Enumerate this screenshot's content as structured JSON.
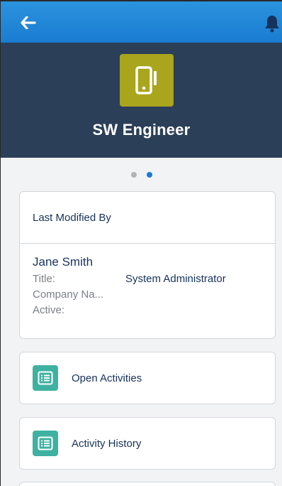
{
  "header": {
    "back_icon": "back-arrow-icon",
    "notification_icon": "bell-icon",
    "bar_color": "#1b7cd1"
  },
  "hero": {
    "title": "SW Engineer",
    "icon": "mobile-device-icon",
    "icon_color": "#a9a51c",
    "background": "#2b3f58"
  },
  "pager": {
    "count": 2,
    "active_index": 1
  },
  "last_modified_card": {
    "heading": "Last Modified By",
    "name": "Jane Smith",
    "fields": [
      {
        "label": "Title:",
        "value": "System Administrator"
      },
      {
        "label": "Company Na...",
        "value": ""
      },
      {
        "label": "Active:",
        "value": ""
      }
    ]
  },
  "related_lists": [
    {
      "label": "Open Activities",
      "icon": "list-icon",
      "icon_color": "#3fb1a1"
    },
    {
      "label": "Activity History",
      "icon": "list-icon",
      "icon_color": "#3fb1a1"
    }
  ]
}
